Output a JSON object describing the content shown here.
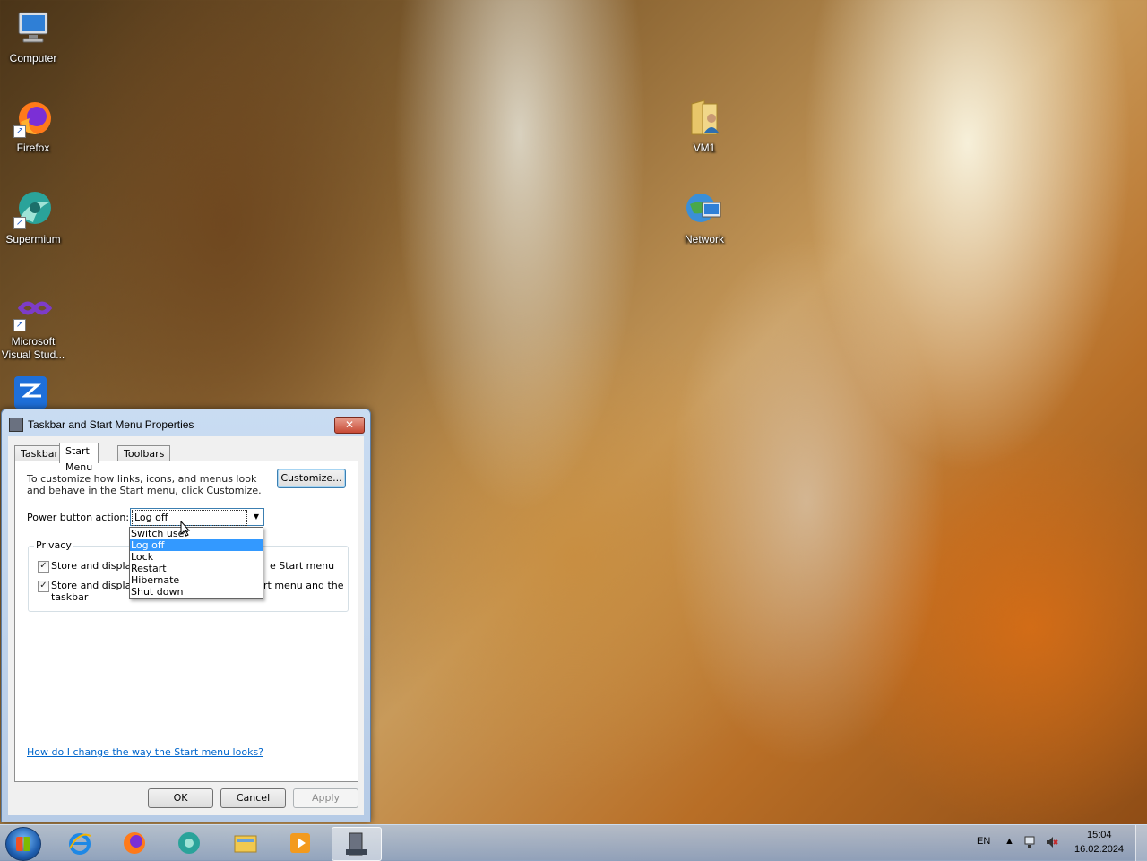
{
  "desktop": {
    "icons": [
      {
        "label": "Computer"
      },
      {
        "label": "Firefox"
      },
      {
        "label": "Supermium"
      },
      {
        "label": "Microsoft Visual Stud..."
      },
      {
        "label": "VM1"
      },
      {
        "label": "Network"
      }
    ]
  },
  "dialog": {
    "title": "Taskbar and Start Menu Properties",
    "close_label": "✕",
    "tabs": [
      {
        "label": "Taskbar"
      },
      {
        "label": "Start Menu"
      },
      {
        "label": "Toolbars"
      }
    ],
    "description": "To customize how links, icons, and menus look and behave in the Start menu, click Customize.",
    "customize_label": "Customize...",
    "power_label": "Power button action:",
    "power_value": "Log off",
    "power_options": [
      "Switch user",
      "Log off",
      "Lock",
      "Restart",
      "Hibernate",
      "Shut down"
    ],
    "privacy_label": "Privacy",
    "privacy_items": [
      {
        "left": "Store and display r",
        "right": "e Start menu",
        "checked": true
      },
      {
        "left": "Store and display r",
        "right": "rt menu and the",
        "extra": "taskbar",
        "checked": true
      }
    ],
    "help_link": "How do I change the way the Start menu looks?",
    "ok_label": "OK",
    "cancel_label": "Cancel",
    "apply_label": "Apply"
  },
  "taskbar": {
    "language": "EN",
    "time": "15:04",
    "date": "16.02.2024"
  },
  "colors": {
    "selection": "#3399ff",
    "link": "#0066cc"
  }
}
